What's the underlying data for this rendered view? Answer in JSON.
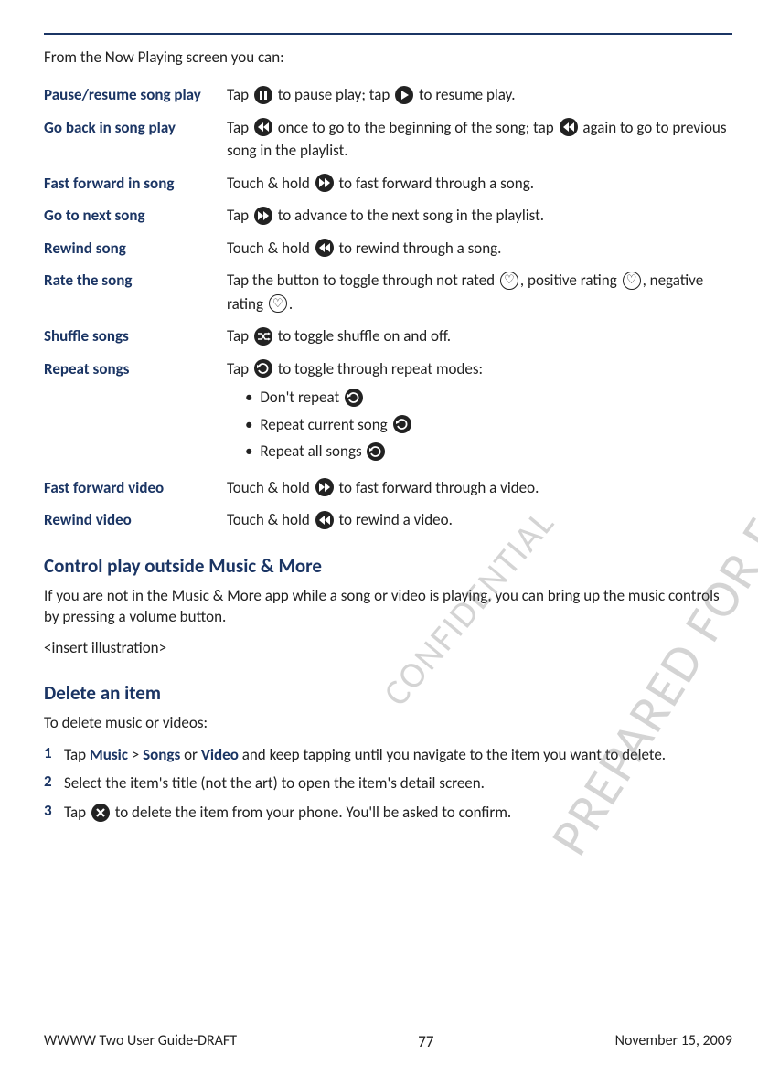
{
  "watermarks": {
    "line1": "PREPARED FOR FCC CERTIFICATION",
    "line2": "CONFIDENTIAL"
  },
  "intro": "From the Now Playing screen you can:",
  "defs": [
    {
      "label": "Pause/resume song play",
      "body": "pause_resume"
    },
    {
      "label": "Go back in song play",
      "body": "go_back"
    },
    {
      "label": "Fast forward in song",
      "body": "fast_forward"
    },
    {
      "label": "Go to next song",
      "body": "go_next"
    },
    {
      "label": "Rewind song",
      "body": "rewind"
    },
    {
      "label": "Rate the song",
      "body": "rate"
    },
    {
      "label": "Shuffle songs",
      "body": "shuffle"
    },
    {
      "label": "Repeat songs",
      "body": "repeat"
    },
    {
      "label": "Fast forward video",
      "body": "ff_video"
    },
    {
      "label": "Rewind video",
      "body": "rw_video"
    }
  ],
  "bodies": {
    "pause_resume": {
      "fragments": [
        "Tap ",
        "__pause__",
        " to pause play; tap ",
        "__play__",
        " to resume play."
      ]
    },
    "go_back": {
      "fragments": [
        "Tap ",
        "__rewind__",
        " once to go to the beginning of the song; tap ",
        "__rewind__",
        " again to go to previous song in the playlist."
      ]
    },
    "fast_forward": {
      "fragments": [
        "Touch & hold ",
        "__fwd__",
        " to fast forward through a song."
      ]
    },
    "go_next": {
      "fragments": [
        "Tap ",
        "__fwd__",
        " to advance to the next song in the playlist."
      ]
    },
    "rewind": {
      "fragments": [
        "Touch & hold ",
        "__rewind__",
        " to rewind through a song."
      ]
    },
    "rate": {
      "fragments": [
        "Tap the button to toggle through not rated ",
        "__heart__",
        ", positive rating ",
        "__heart__",
        ", negative rating ",
        "__heart__",
        "."
      ]
    },
    "shuffle": {
      "fragments": [
        "Tap ",
        "__shuffle__",
        " to toggle shuffle on and off."
      ]
    },
    "repeat": {
      "fragments": [
        "Tap ",
        "__repeat__",
        " to toggle through repeat modes:"
      ],
      "list": [
        {
          "fragments": [
            "Don't repeat ",
            "__repeat__"
          ]
        },
        {
          "fragments": [
            "Repeat current song ",
            "__repeat__"
          ]
        },
        {
          "fragments": [
            "Repeat all songs ",
            "__repeat__"
          ]
        }
      ]
    },
    "ff_video": {
      "fragments": [
        "Touch & hold ",
        "__fwd__",
        " to fast forward through a video."
      ]
    },
    "rw_video": {
      "fragments": [
        "Touch & hold ",
        "__rewind__",
        " to rewind a video."
      ]
    }
  },
  "section_control_title": "Control play outside Music & More",
  "section_control_p1": "If you are not in the Music & More app while a song or video is playing, you can bring up the music controls by pressing a volume button.",
  "section_control_p2": "<insert illustration>",
  "section_delete_title": "Delete an item",
  "section_delete_intro": "To delete music or videos:",
  "steps": [
    {
      "num": "1",
      "fragments": [
        "Tap ",
        {
          "emph": "Music"
        },
        " > ",
        {
          "emph": "Songs"
        },
        " or ",
        {
          "emph": "Video"
        },
        " and keep tapping until you navigate to the item you want to delete."
      ]
    },
    {
      "num": "2",
      "fragments": [
        "Select the item's title (not the art) to open the item's detail screen."
      ]
    },
    {
      "num": "3",
      "fragments": [
        "Tap ",
        "__close__",
        " to delete the item from your phone. You'll be asked to confirm."
      ]
    }
  ],
  "footer": {
    "left": "WWWW Two User Guide-DRAFT",
    "center": "77",
    "right": "November 15, 2009"
  },
  "icons": {
    "pause": "pause-icon",
    "play": "play-icon",
    "rewind": "rewind-icon",
    "fwd": "forward-icon",
    "heart": "heart-icon",
    "shuffle": "shuffle-icon",
    "repeat": "repeat-icon",
    "close": "close-icon"
  }
}
